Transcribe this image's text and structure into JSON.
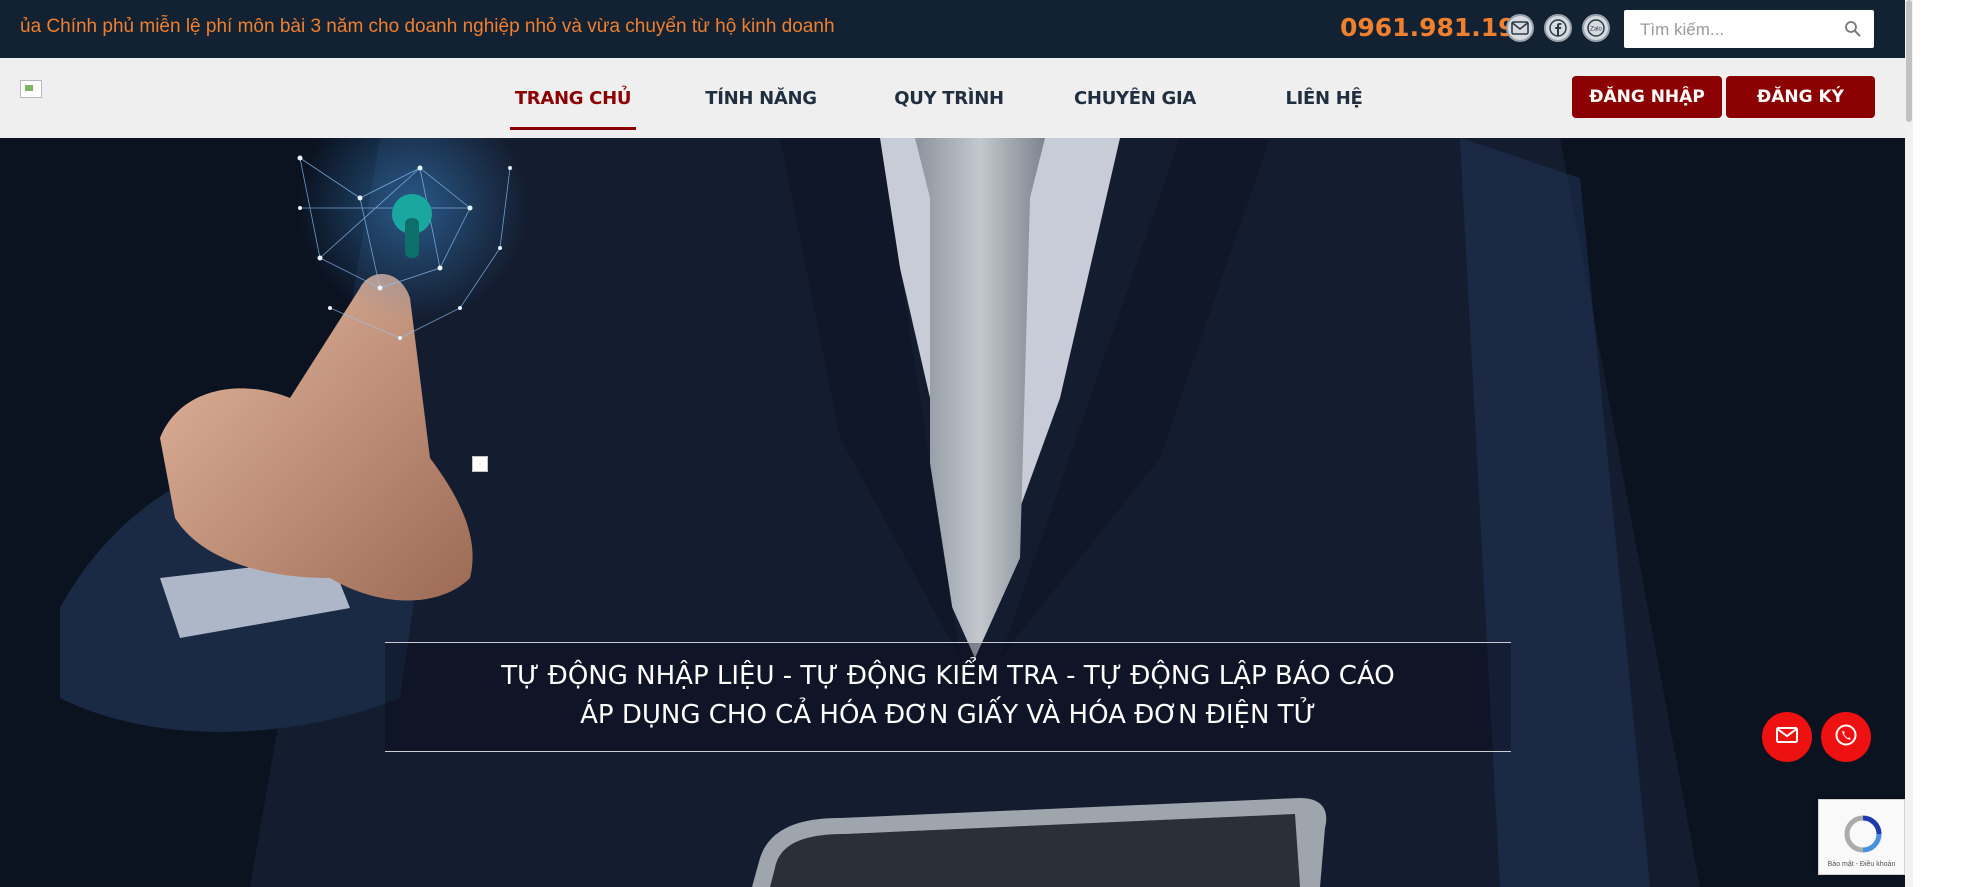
{
  "topbar": {
    "marquee_text": "ủa Chính phủ miễn lệ phí môn bài 3 năm cho doanh nghiệp nhỏ và vừa chuyển từ hộ kinh doanh",
    "hotline": "0961.981.199",
    "social_icons": [
      "mail-icon",
      "facebook-icon",
      "zalo-icon"
    ],
    "zalo_label": "Zalo",
    "search_placeholder": "Tìm kiếm..."
  },
  "nav": {
    "items": [
      {
        "label": "TRANG CHỦ",
        "active": true
      },
      {
        "label": "TÍNH NĂNG",
        "active": false
      },
      {
        "label": "QUY TRÌNH",
        "active": false
      },
      {
        "label": "CHUYÊN GIA",
        "active": false
      },
      {
        "label": "LIÊN HỆ",
        "active": false
      }
    ],
    "login_label": "ĐĂNG NHẬP",
    "register_label": "ĐĂNG KÝ"
  },
  "hero": {
    "line1": "TỰ ĐỘNG NHẬP LIỆU - TỰ ĐỘNG KIỂM TRA - TỰ ĐỘNG LẬP BÁO CÁO",
    "line2": "ÁP DỤNG CHO CẢ HÓA ĐƠN GIẤY VÀ HÓA ĐƠN ĐIỆN TỬ"
  },
  "floating": {
    "buttons": [
      "mail-icon",
      "phone-icon"
    ]
  },
  "recaptcha": {
    "footer_text": "Bảo mật - Điều khoản"
  },
  "colors": {
    "topbar_bg": "#122232",
    "accent_orange": "#f07f2e",
    "brand_red": "#8b0000",
    "fab_red": "#ee1111",
    "navbar_bg": "#efefef"
  }
}
